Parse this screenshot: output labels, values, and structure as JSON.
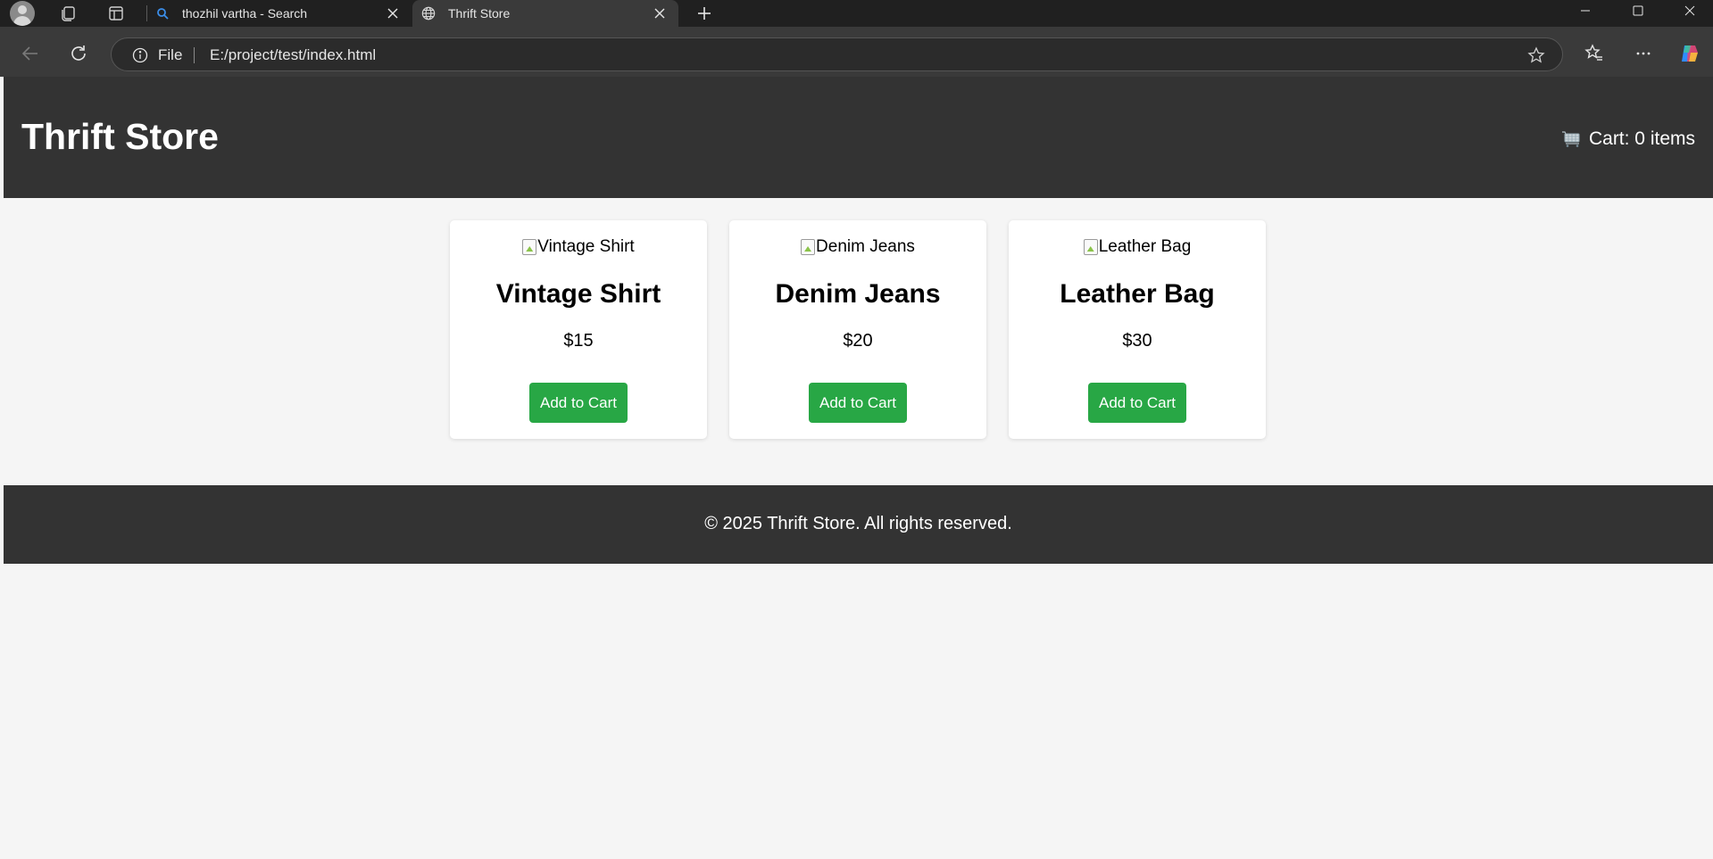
{
  "browser": {
    "tabs": [
      {
        "title": "thozhil vartha - Search",
        "icon": "search-icon"
      },
      {
        "title": "Thrift Store",
        "icon": "globe-icon",
        "active": true
      }
    ],
    "address": {
      "scheme_label": "File",
      "url": "E:/project/test/index.html"
    }
  },
  "site": {
    "title": "Thrift Store",
    "cart_label": "Cart: 0 items",
    "cart_icon": "cart-icon",
    "products": [
      {
        "image_alt": "Vintage Shirt",
        "name": "Vintage Shirt",
        "price": "$15",
        "button": "Add to Cart"
      },
      {
        "image_alt": "Denim Jeans",
        "name": "Denim Jeans",
        "price": "$20",
        "button": "Add to Cart"
      },
      {
        "image_alt": "Leather Bag",
        "name": "Leather Bag",
        "price": "$30",
        "button": "Add to Cart"
      }
    ],
    "footer": "© 2025 Thrift Store. All rights reserved."
  },
  "colors": {
    "header_bg": "#333333",
    "page_bg": "#f5f5f5",
    "button_bg": "#28a745",
    "card_bg": "#ffffff"
  }
}
